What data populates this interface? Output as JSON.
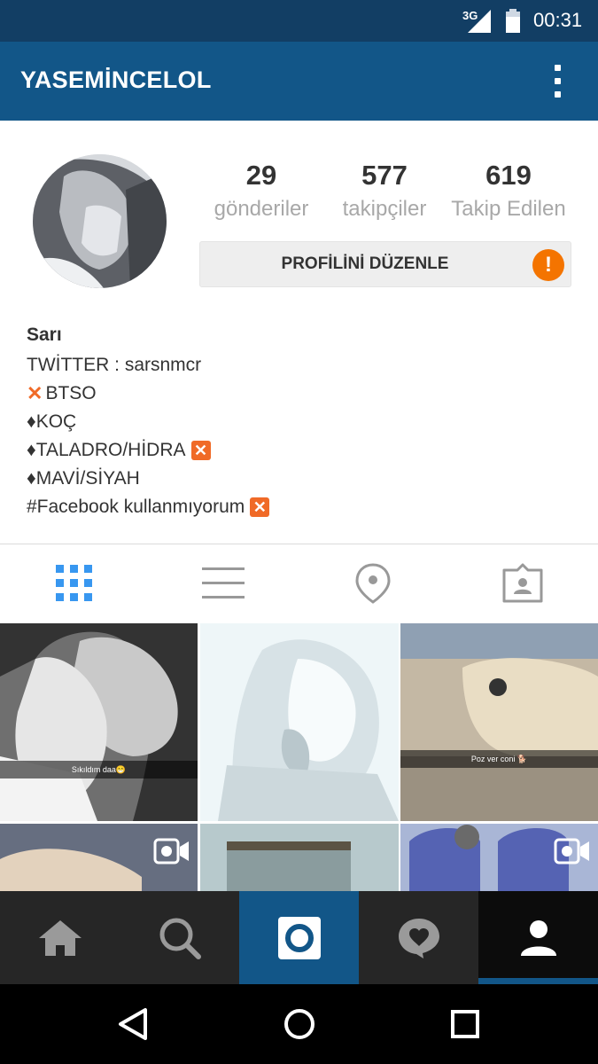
{
  "status_bar": {
    "network": "3G",
    "time": "00:31"
  },
  "header": {
    "username": "YASEMİNCELOL",
    "menu_icon": "more-vert-icon",
    "bar_color": "#125688"
  },
  "profile": {
    "stats": [
      {
        "value": "29",
        "label": "gönderiler"
      },
      {
        "value": "577",
        "label": "takipçiler"
      },
      {
        "value": "619",
        "label": "Takip Edilen"
      }
    ],
    "edit_label": "PROFİLİNİ DÜZENLE",
    "warning_symbol": "!",
    "warning_color": "#f47400"
  },
  "bio": {
    "name": "Sarı",
    "lines": [
      {
        "prefix": "",
        "text": "TWİTTER : sarsnmcr",
        "suffix": ""
      },
      {
        "prefix": "✕",
        "text": "BTSO",
        "suffix": ""
      },
      {
        "prefix": "",
        "text": "♦KOÇ",
        "suffix": ""
      },
      {
        "prefix": "",
        "text": "♦TALADRO/HİDRA",
        "suffix": "✕"
      },
      {
        "prefix": "",
        "text": "♦MAVİ/SİYAH",
        "suffix": ""
      },
      {
        "prefix": "",
        "text": "#Facebook kullanmıyorum",
        "suffix": "✕"
      }
    ]
  },
  "tabs": [
    {
      "icon": "grid-view-icon",
      "active": true
    },
    {
      "icon": "list-view-icon",
      "active": false
    },
    {
      "icon": "location-pin-icon",
      "active": false
    },
    {
      "icon": "tagged-photos-icon",
      "active": false
    }
  ],
  "grid": {
    "captions": [
      "Sıkıldım daa😁",
      "Poz ver coni 🐕"
    ],
    "video_icon": "video-camera-icon"
  },
  "bottom_nav": [
    {
      "icon": "home-icon"
    },
    {
      "icon": "search-icon"
    },
    {
      "icon": "camera-icon"
    },
    {
      "icon": "activity-heart-icon"
    },
    {
      "icon": "profile-icon"
    }
  ],
  "system_nav": [
    {
      "icon": "back-icon"
    },
    {
      "icon": "home-circle-icon"
    },
    {
      "icon": "recents-icon"
    }
  ]
}
